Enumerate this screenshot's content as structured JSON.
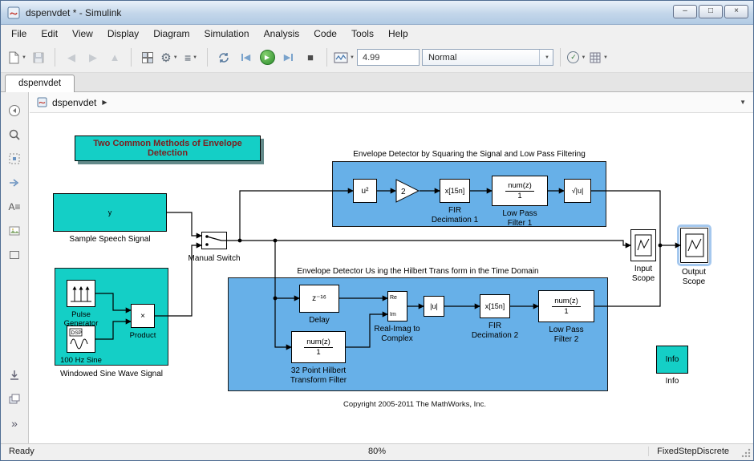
{
  "window": {
    "title": "dspenvdet * - Simulink",
    "minimize": "–",
    "maximize": "□",
    "close": "×"
  },
  "menu": {
    "items": [
      "File",
      "Edit",
      "View",
      "Display",
      "Diagram",
      "Simulation",
      "Analysis",
      "Code",
      "Tools",
      "Help"
    ]
  },
  "icons": {
    "dropdown": "▼",
    "back": "◀",
    "forward": "▶",
    "up": "▲",
    "gear": "⚙",
    "list": "≡",
    "play": "▶",
    "stop": "■",
    "check": "✓",
    "crumb_arrow": "▶",
    "chevrons": "»",
    "annotation": "A≡"
  },
  "toolbar": {
    "sim_time": "4.99",
    "sim_mode": "Normal"
  },
  "tab": {
    "label": "dspenvdet"
  },
  "breadcrumb": {
    "model": "dspenvdet"
  },
  "status": {
    "ready": "Ready",
    "zoom": "80%",
    "solver": "FixedStepDiscrete"
  },
  "canvas": {
    "title_block": "Two Common Methods of Envelope Detection",
    "copyright": "Copyright 2005-2011 The MathWorks, Inc.",
    "speech": {
      "content": "y",
      "label": "Sample Speech Signal"
    },
    "manual_switch": {
      "label": "Manual Switch"
    },
    "windowed": {
      "label": "Windowed Sine Wave Signal",
      "pulse_label": [
        "Pulse",
        "Generator"
      ],
      "sine_icon": "DSP",
      "sine_label": "100 Hz Sine",
      "product_symbol": "×",
      "product_label": "Product"
    },
    "upper": {
      "title": "Envelope Detector by Squaring the Signal and Low Pass Filtering",
      "u2": "u²",
      "gain": "2",
      "fir": "x[15n]",
      "fir_label": [
        "FIR",
        "Decimation 1"
      ],
      "lpf_num": "num(z)",
      "lpf_den": "1",
      "lpf_label": [
        "Low Pass",
        "Filter 1"
      ],
      "sqrt": "√|u|"
    },
    "lower": {
      "title": "Envelope Detector Us ing the Hilbert Trans form in the Time Domain",
      "delay": "z⁻¹⁶",
      "delay_label": "Delay",
      "hilbert_num": "num(z)",
      "hilbert_den": "1",
      "hilbert_label": [
        "32 Point Hilbert",
        "Transform Filter"
      ],
      "reim_ports": [
        "Re",
        "Im"
      ],
      "reim_label": [
        "Real-Imag to",
        "Complex"
      ],
      "mag": "|u|",
      "fir": "x[15n]",
      "fir_label": [
        "FIR",
        "Decimation 2"
      ],
      "lpf_num": "num(z)",
      "lpf_den": "1",
      "lpf_label": [
        "Low Pass",
        "Filter 2"
      ]
    },
    "input_scope_label": [
      "Input",
      "Scope"
    ],
    "output_scope_label": [
      "Output",
      "Scope"
    ],
    "info": {
      "content": "Info",
      "label": "Info"
    }
  }
}
